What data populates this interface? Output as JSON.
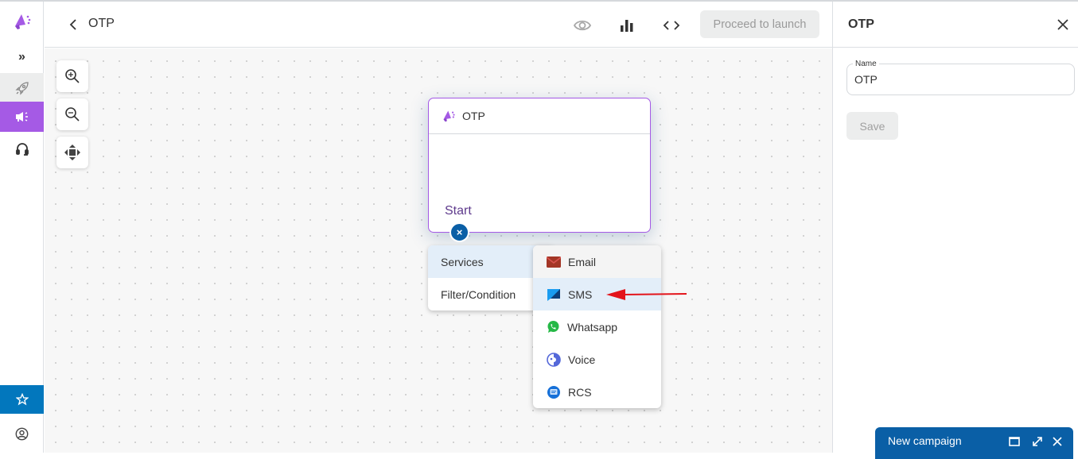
{
  "colors": {
    "brand_purple": "#a55ae5",
    "primary_blue": "#0a5fa6",
    "sidebar_star_bg": "#0277bd",
    "active_item_bg": "#e3eef9",
    "arrow_red": "#e3141b"
  },
  "sidebar": {
    "items": [
      {
        "name": "logo",
        "icon": "megaphone-logo-icon"
      },
      {
        "name": "expand",
        "icon": "chevrons-right-icon",
        "label": "»"
      },
      {
        "name": "launch",
        "icon": "rocket-icon"
      },
      {
        "name": "campaigns",
        "icon": "megaphone-icon",
        "active": true
      },
      {
        "name": "support",
        "icon": "headset-icon"
      },
      {
        "name": "favorites",
        "icon": "star-icon"
      },
      {
        "name": "profile",
        "icon": "user-circle-icon"
      }
    ]
  },
  "header": {
    "title": "OTP",
    "icons": [
      "eye-icon",
      "bar-chart-icon",
      "code-icon"
    ],
    "proceed_label": "Proceed to launch"
  },
  "canvas": {
    "controls": [
      "zoom-in-icon",
      "zoom-out-icon",
      "move-icon"
    ],
    "node": {
      "title": "OTP",
      "footer": "Start",
      "close_glyph": "×"
    },
    "menu": {
      "items": [
        {
          "label": "Services",
          "active": true
        },
        {
          "label": "Filter/Condition",
          "active": false
        }
      ]
    },
    "submenu": {
      "items": [
        {
          "label": "Email",
          "icon": "email-icon"
        },
        {
          "label": "SMS",
          "icon": "sms-icon",
          "highlighted": true
        },
        {
          "label": "Whatsapp",
          "icon": "whatsapp-icon"
        },
        {
          "label": "Voice",
          "icon": "voice-icon"
        },
        {
          "label": "RCS",
          "icon": "rcs-icon"
        }
      ]
    }
  },
  "right_panel": {
    "title": "OTP",
    "name_label": "Name",
    "name_value": "OTP",
    "save_label": "Save"
  },
  "toast": {
    "title": "New campaign"
  }
}
